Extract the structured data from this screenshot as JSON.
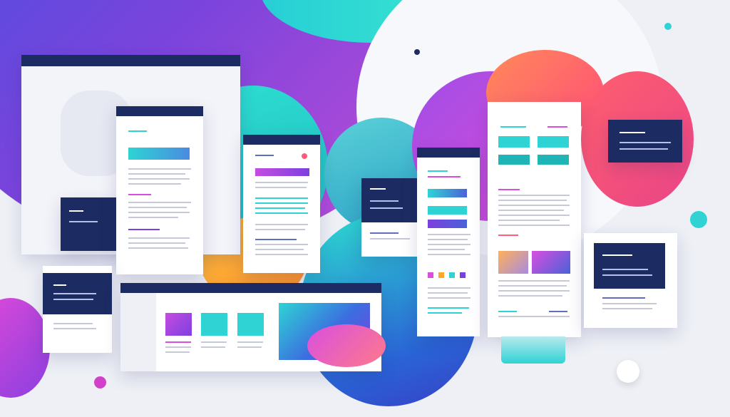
{
  "palette": {
    "background": "#eef0f6",
    "navy": "#1c2c63",
    "purple": "#7d3fe0",
    "magenta": "#d84fe0",
    "cyan": "#2fd3d4",
    "teal": "#1fb5b7",
    "coral": "#ff5d7a",
    "orange": "#ffa62b",
    "blue": "#4a62d8",
    "line_gray": "#c5c9d8",
    "line_blue": "#5f6fbf"
  },
  "decorations": {
    "blobs": [
      "gradient-circle",
      "gradient-circle",
      "gradient-circle"
    ],
    "icons": [
      "browser-window-icon",
      "document-page-icon",
      "image-placeholder-icon",
      "color-swatch-icon"
    ]
  },
  "illustration": {
    "subject": "website-wireframe-pages",
    "text_legible": false
  }
}
